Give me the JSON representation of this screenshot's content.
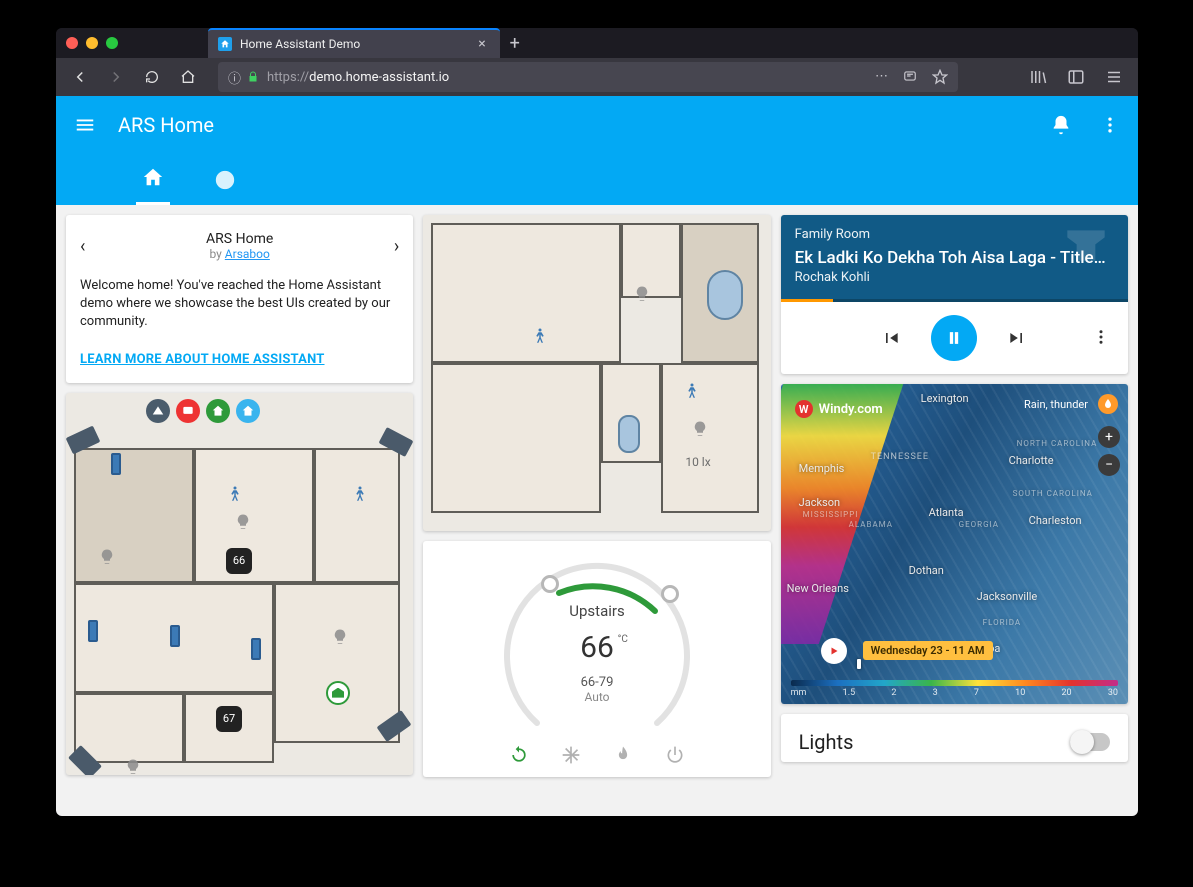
{
  "browser": {
    "tab_title": "Home Assistant Demo",
    "url_prefix": "https://",
    "url_domain": "demo.home-assistant.io",
    "url_path": ""
  },
  "header": {
    "title": "ARS Home"
  },
  "welcome": {
    "title": "ARS Home",
    "by_label": "by",
    "author": "Arsaboo",
    "body": "Welcome home! You've reached the Home Assistant demo where we showcase the best UIs created by our community.",
    "learn_more": "LEARN MORE ABOUT HOME ASSISTANT"
  },
  "floorplan2": {
    "lux_label": "10 lx"
  },
  "floorplan1": {
    "thermo_a": "66",
    "thermo_b": "67"
  },
  "thermostat": {
    "name": "Upstairs",
    "current": "66",
    "unit": "°C",
    "range": "66-79",
    "mode": "Auto"
  },
  "media": {
    "room": "Family Room",
    "title": "Ek Ladki Ko Dekha Toh Aisa Laga - Title…",
    "artist": "Rochak Kohli"
  },
  "weather": {
    "brand": "Windy.com",
    "layer_label": "Rain, thunder",
    "time_badge": "Wednesday 23 - 11 AM",
    "scale_unit": "mm",
    "scale_ticks": [
      "1.5",
      "2",
      "3",
      "7",
      "10",
      "20",
      "30"
    ],
    "cities": {
      "lexington": "Lexington",
      "tennessee": "TENNESSEE",
      "memphis": "Memphis",
      "charlotte": "Charlotte",
      "nc": "NORTH CAROLINA",
      "atlanta": "Atlanta",
      "alabama": "ALABAMA",
      "georgia": "GEORGIA",
      "charleston": "Charleston",
      "jackson": "Jackson",
      "miss": "MISSISSIPPI",
      "dothan": "Dothan",
      "jax": "Jacksonville",
      "neworleans": "New Orleans",
      "florida": "FLORIDA",
      "tampa": "Tampa",
      "sc": "SOUTH CAROLINA"
    }
  },
  "lights": {
    "title": "Lights"
  }
}
